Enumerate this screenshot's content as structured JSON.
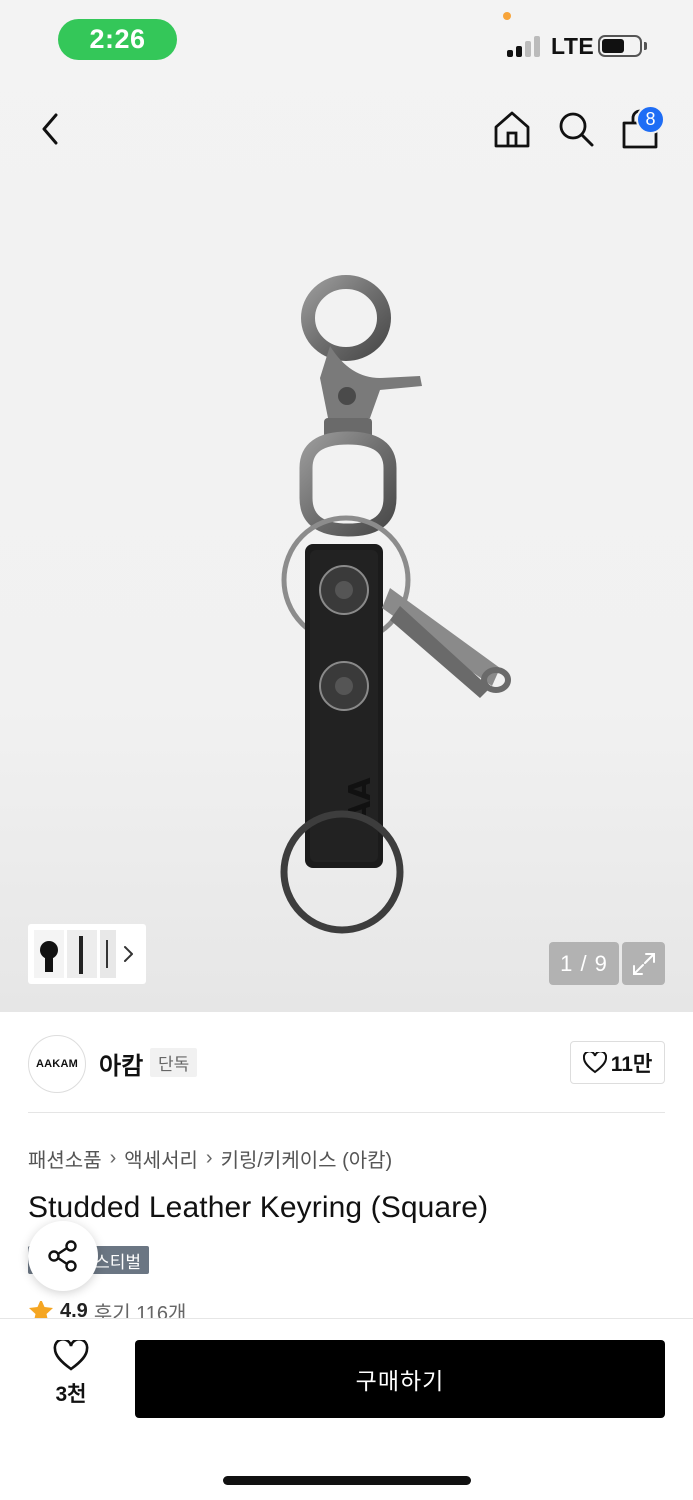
{
  "status_bar": {
    "time": "2:26",
    "network": "LTE"
  },
  "nav": {
    "cart_count": "8"
  },
  "gallery": {
    "counter": "1 / 9"
  },
  "brand": {
    "logo_text": "AAKAM",
    "name": "아캄",
    "tag": "단독",
    "likes": "11만"
  },
  "breadcrumb": {
    "items": [
      "패션소품",
      "액세서리",
      "키링/키케이스 (아캄)"
    ]
  },
  "product": {
    "title": "Studded Leather Keyring (Square)",
    "badge": "스티벌",
    "rating": "4.9",
    "reviews": "후기 116개"
  },
  "bottom": {
    "wish_count": "3천",
    "buy_label": "구매하기"
  },
  "colors": {
    "accent_badge": "#1e6df5",
    "status_pill": "#34c759",
    "star": "#f5a623"
  }
}
